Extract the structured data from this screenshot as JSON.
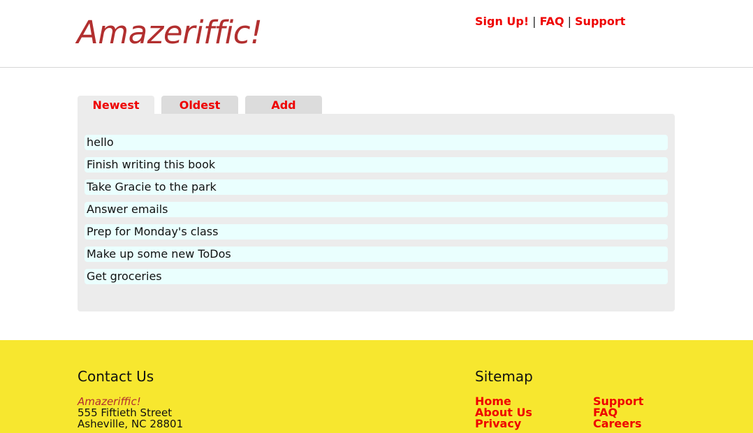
{
  "header": {
    "logo": "Amazeriffic!",
    "nav": [
      {
        "label": "Sign Up!"
      },
      {
        "label": "FAQ"
      },
      {
        "label": "Support"
      }
    ],
    "separator": "|"
  },
  "tabs": [
    {
      "label": "Newest",
      "active": true
    },
    {
      "label": "Oldest",
      "active": false
    },
    {
      "label": "Add",
      "active": false
    }
  ],
  "todos": [
    "hello",
    "Finish writing this book",
    "Take Gracie to the park",
    "Answer emails",
    "Prep for Monday's class",
    "Make up some new ToDos",
    "Get groceries"
  ],
  "footer": {
    "contact": {
      "heading": "Contact Us",
      "company": "Amazeriffic!",
      "street": "555 Fiftieth Street",
      "city": "Asheville, NC 28801"
    },
    "sitemap": {
      "heading": "Sitemap",
      "column1": [
        "Home",
        "About Us",
        "Privacy"
      ],
      "column2": [
        "Support",
        "FAQ",
        "Careers"
      ]
    }
  },
  "colors": {
    "link": "#ee0000",
    "logo": "#b22f2f",
    "footer_bg": "#f7e72f",
    "panel_bg": "#ececec",
    "tab_inactive_bg": "#dcdcdc",
    "todo_bg": "#eafffe"
  }
}
